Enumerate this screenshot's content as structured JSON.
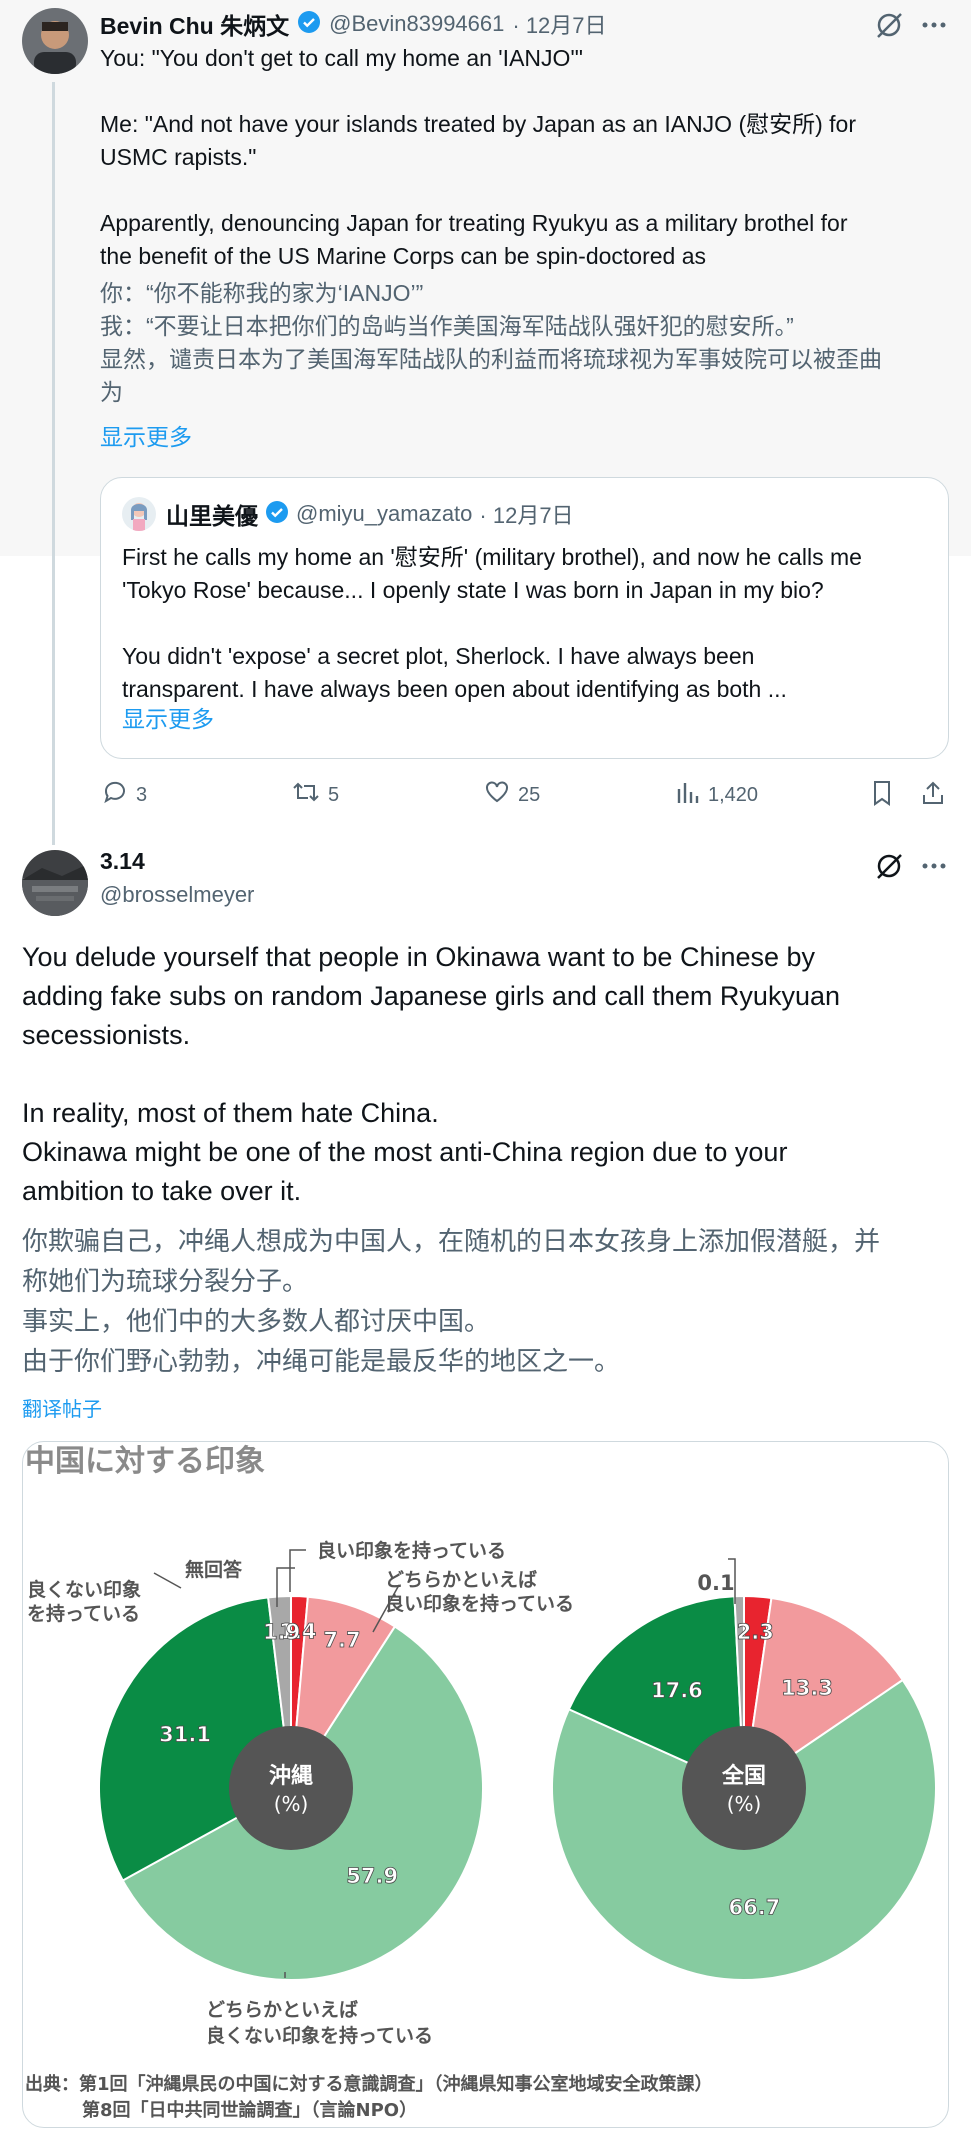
{
  "tweet1": {
    "author": "Bevin Chu 朱炳文",
    "handle": "@Bevin83994661",
    "date": "· 12月7日",
    "lines": [
      "You: \"You don't get to call my home an 'IANJO'\"",
      "Me: \"And not have your islands treated by Japan as an IANJO (慰安所) for",
      "USMC rapists.\"",
      "Apparently, denouncing Japan for treating Ryukyu as a military brothel for",
      "the benefit of the US Marine Corps can be spin-doctored as"
    ],
    "translation": [
      "你：“你不能称我的家为‘IANJO’”",
      "我：“不要让日本把你们的岛屿当作美国海军陆战队强奸犯的慰安所。”",
      "显然，谴责日本为了美国海军陆战队的利益而将琉球视为军事妓院可以被歪曲",
      "为"
    ],
    "show_more": "显示更多",
    "quote": {
      "author": "山里美優",
      "handle": "@miyu_yamazato",
      "date": "· 12月7日",
      "lines": [
        "First he calls my home an '慰安所' (military brothel), and now he calls me",
        "'Tokyo Rose' because... I openly state I was born in Japan in my bio?",
        "You didn't 'expose' a secret plot, Sherlock. I have always been",
        "transparent. I have always been open about identifying as both ..."
      ],
      "show_more": "显示更多"
    },
    "actions": {
      "replies": "3",
      "retweets": "5",
      "likes": "25",
      "views": "1,420"
    }
  },
  "tweet2": {
    "author": "3.14",
    "handle": "@brosselmeyer",
    "lines": [
      "You delude yourself that people in Okinawa want to be Chinese by",
      "adding fake subs on random Japanese girls and call them Ryukyuan",
      "secessionists.",
      "In reality, most of them hate China.",
      "Okinawa might be one of the most anti-China region due to your",
      "ambition to take over it."
    ],
    "translation": [
      "你欺骗自己，冲绳人想成为中国人，在随机的日本女孩身上添加假潜艇，并",
      "称她们为琉球分裂分子。",
      "事实上，他们中的大多数人都讨厌中国。",
      "由于你们野心勃勃，冲绳可能是最反华的地区之一。"
    ],
    "translate_link": "翻译帖子"
  },
  "chart_data": {
    "type": "pie",
    "title": "中国に対する印象",
    "categories": [
      "良い印象を持っている",
      "どちらかといえば良い印象を持っている",
      "どちらかといえば良くない印象を持っている",
      "良くない印象を持っている",
      "無回答"
    ],
    "colors": [
      "#e8242f",
      "#f29a9d",
      "#86cba0",
      "#0a8c45",
      "#a8a8a8"
    ],
    "series": [
      {
        "name": "沖縄",
        "unit": "(%)",
        "values": [
          1.4,
          7.7,
          57.9,
          31.1,
          1.9
        ]
      },
      {
        "name": "全国",
        "unit": "(%)",
        "values": [
          2.3,
          13.3,
          66.7,
          17.6,
          0.1
        ]
      }
    ],
    "labels": {
      "good": "良い印象を持っている",
      "rather_good_1": "どちらかといえば",
      "rather_good_2": "良い印象を持っている",
      "rather_bad_1": "どちらかといえば",
      "rather_bad_2": "良くない印象を持っている",
      "bad_1": "良くない印象",
      "bad_2": "を持っている",
      "no_answer": "無回答"
    },
    "source_1": "出典：第1回「沖縄県民の中国に対する意識調査」（沖縄県知事公室地域安全政策課）",
    "source_2": "第8回「日中共同世論調査」（言論NPO）"
  }
}
